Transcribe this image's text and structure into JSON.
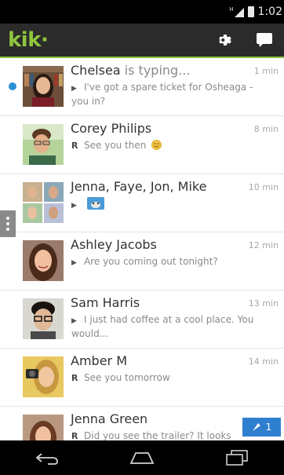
{
  "status_bar": {
    "network": "H",
    "time": "1:02"
  },
  "app_bar": {
    "logo": "kik",
    "logo_dot": "·",
    "brand_color": "#8fc63f"
  },
  "chats": [
    {
      "name": "Chelsea",
      "typing": "is typing...",
      "time": "1 min",
      "indicator": "sent",
      "preview": "I've got a spare ticket for Osheaga - you in?",
      "unread_dot": true
    },
    {
      "name": "Corey Philips",
      "time": "8 min",
      "indicator": "read",
      "preview": "See you then"
    },
    {
      "name": "Jenna, Faye, Jon, Mike",
      "time": "10 min",
      "indicator": "sent",
      "preview": ""
    },
    {
      "name": "Ashley Jacobs",
      "time": "12 min",
      "indicator": "sent",
      "preview": "Are you coming out tonight?"
    },
    {
      "name": "Sam Harris",
      "time": "13 min",
      "indicator": "sent",
      "preview": "I just had coffee at a cool place. You would..."
    },
    {
      "name": "Amber M",
      "time": "14 min",
      "indicator": "read",
      "preview": "See you tomorrow"
    },
    {
      "name": "Jenna Green",
      "time": "",
      "indicator": "read",
      "preview": "Did you see the trailer? It looks",
      "unread_count": "1"
    }
  ],
  "colors": {
    "accent": "#8fc63f",
    "unread_blue": "#2f7fd0",
    "dot_blue": "#2d8fd6"
  },
  "icons": [
    "gear-icon",
    "chat-bubble-icon",
    "back-icon",
    "home-icon",
    "recent-apps-icon",
    "smiley-icon",
    "sticker-icon",
    "menu-handle-icon"
  ]
}
